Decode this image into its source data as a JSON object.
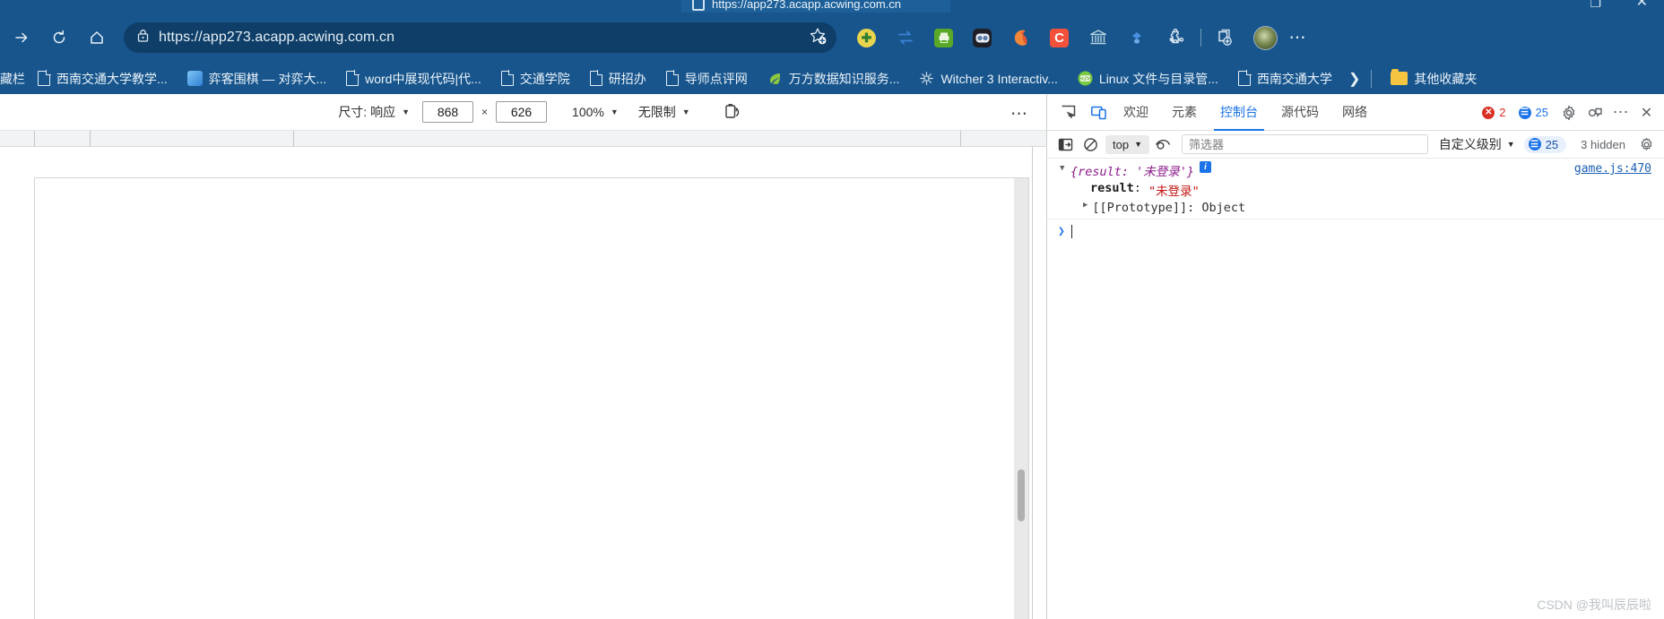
{
  "browser": {
    "tab": {
      "title": "https://app273.acapp.acwing.com.cn",
      "favicon": "page-icon"
    },
    "nav": {
      "forward_icon": "arrow-right-icon",
      "reload_icon": "reload-icon",
      "home_icon": "home-icon"
    },
    "omnibox": {
      "lock_icon": "lock-icon",
      "url": "https://app273.acapp.acwing.com.cn",
      "favorite_icon": "add-favorite-star-icon"
    },
    "extensions": [
      {
        "name": "extension-green-plus",
        "glyph": "✚",
        "bg": "#e8d44d",
        "fg": "#2f7d32"
      },
      {
        "name": "extension-swap-arrows",
        "glyph": "⇄",
        "bg": "transparent",
        "fg": "#3b82d6"
      },
      {
        "name": "extension-green-printer",
        "glyph": "⎙",
        "bg": "#5aa828",
        "fg": "#ffffff"
      },
      {
        "name": "extension-dark-goggles",
        "glyph": "◦◦",
        "bg": "#1f1f28",
        "fg": "#8fb4e0"
      },
      {
        "name": "extension-orange-moon",
        "glyph": "☾",
        "bg": "transparent",
        "fg": "#f08a2a"
      },
      {
        "name": "extension-red-c",
        "glyph": "C",
        "bg": "#f4513c",
        "fg": "#ffffff"
      },
      {
        "name": "extension-bank-building",
        "glyph": "🏛",
        "bg": "transparent",
        "fg": "#b8d6e0"
      },
      {
        "name": "extension-blue-diamond",
        "glyph": "◆",
        "bg": "transparent",
        "fg": "#4a90e2"
      },
      {
        "name": "extension-puzzle",
        "glyph": "✼",
        "bg": "transparent",
        "fg": "#d8e6f0"
      }
    ],
    "collections_icon": "collections-add-icon",
    "profile_icon": "profile-avatar",
    "more_icon": "browser-more-icon",
    "bookmarks": {
      "clipped_label": "藏栏",
      "items": [
        {
          "label": "西南交通大学教学...",
          "icon": "page-icon",
          "icon_type": "doc"
        },
        {
          "label": "弈客围棋 — 对弈大...",
          "icon": "yike-go-icon",
          "icon_type": "img",
          "color": "#2f7fd4"
        },
        {
          "label": "word中展现代码|代...",
          "icon": "page-icon",
          "icon_type": "doc"
        },
        {
          "label": "交通学院",
          "icon": "page-icon",
          "icon_type": "doc"
        },
        {
          "label": "研招办",
          "icon": "page-icon",
          "icon_type": "doc"
        },
        {
          "label": "导师点评网",
          "icon": "page-icon",
          "icon_type": "doc"
        },
        {
          "label": "万方数据知识服务...",
          "icon": "wanfang-leaf-icon",
          "icon_type": "img",
          "color": "#8dc63f"
        },
        {
          "label": "Witcher 3 Interactiv...",
          "icon": "witcher-icon",
          "icon_type": "img",
          "color": "#d4dde4"
        },
        {
          "label": "Linux 文件与目录管...",
          "icon": "code-icon",
          "icon_type": "img",
          "color": "#7ac943"
        },
        {
          "label": "西南交通大学",
          "icon": "page-icon",
          "icon_type": "doc"
        }
      ],
      "overflow_icon": "bookmarks-overflow-chevron",
      "other_folder": {
        "label": "其他收藏夹",
        "icon": "folder-icon"
      }
    }
  },
  "device_toolbar": {
    "size_label": "尺寸: 响应",
    "width": "868",
    "height": "626",
    "times_symbol": "×",
    "zoom_label": "100%",
    "throttling_label": "无限制",
    "rotate_icon": "rotate-device-icon",
    "more_icon": "device-more-icon"
  },
  "devtools": {
    "inspect_icon": "inspect-element-icon",
    "device_toggle_icon": "toggle-device-toolbar-icon",
    "tabs": [
      {
        "label": "欢迎",
        "selected": false
      },
      {
        "label": "元素",
        "selected": false
      },
      {
        "label": "控制台",
        "selected": true
      },
      {
        "label": "源代码",
        "selected": false
      },
      {
        "label": "网络",
        "selected": false
      }
    ],
    "error_badge": {
      "count": "2",
      "color": "#d93025",
      "glyph": "✕"
    },
    "message_badge": {
      "count": "25",
      "color": "#1a73e8",
      "glyph": "≡"
    },
    "settings_icon": "gear-icon",
    "feedback_icon": "feedback-icon",
    "more_icon": "devtools-more-icon",
    "close_icon": "close-icon"
  },
  "console": {
    "sidebar_toggle_icon": "console-sidebar-icon",
    "clear_icon": "clear-console-icon",
    "context": "top",
    "context_caret": "▼",
    "eye_icon": "live-expression-eye-icon",
    "filter_placeholder": "筛选器",
    "filter_value": "",
    "level_label": "自定义级别",
    "level_caret": "▼",
    "count_badge": "25",
    "hidden_label": "3 hidden",
    "settings_icon": "console-settings-gear-icon",
    "messages": [
      {
        "preview": "{result: '未登录'}",
        "has_info_badge": true,
        "source": "game.js:470",
        "property_name": "result",
        "property_value": "\"未登录\"",
        "prototype_line": "[[Prototype]]: Object"
      }
    ],
    "prompt_caret": "❯"
  },
  "watermark": "CSDN @我叫辰辰啦",
  "colors": {
    "chrome_blue": "#18558c",
    "omnibox_blue": "#0f3f68",
    "accent_blue": "#1a73e8",
    "error_red": "#d93025",
    "string_red": "#c41a16",
    "object_purple": "#881391"
  }
}
